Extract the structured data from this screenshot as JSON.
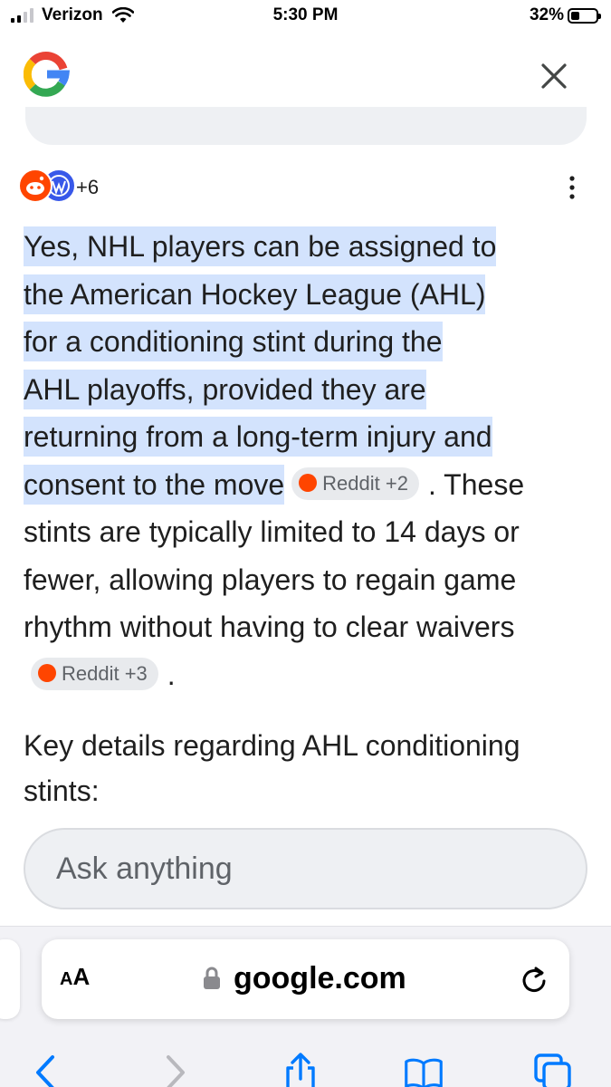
{
  "status_bar": {
    "carrier": "Verizon",
    "time": "5:30 PM",
    "battery": "32%"
  },
  "sources": {
    "count_label": "+6"
  },
  "answer": {
    "highlighted_lines": [
      "Yes, NHL players can be assigned to",
      "the American Hockey League (AHL)",
      "for a conditioning stint during the",
      "AHL playoffs, provided they are",
      "returning from a long-term injury and",
      "consent to the move"
    ],
    "chip1": "Reddit +2",
    "after_chip1": ".",
    "rest_text": "These stints are typically limited to 14 days or fewer, allowing players to regain game rhythm without having to clear waivers",
    "chip2": "Reddit +3",
    "after_chip2": "."
  },
  "key_details": "Key details regarding AHL conditioning stints:",
  "ask": {
    "placeholder": "Ask anything"
  },
  "browser": {
    "aa_large": "A",
    "aa_small": "A",
    "url": "google.com"
  },
  "colors": {
    "highlight": "#d3e3fd",
    "reddit": "#ff4500",
    "wordpress": "#3858e9",
    "ios_blue": "#007aff"
  }
}
